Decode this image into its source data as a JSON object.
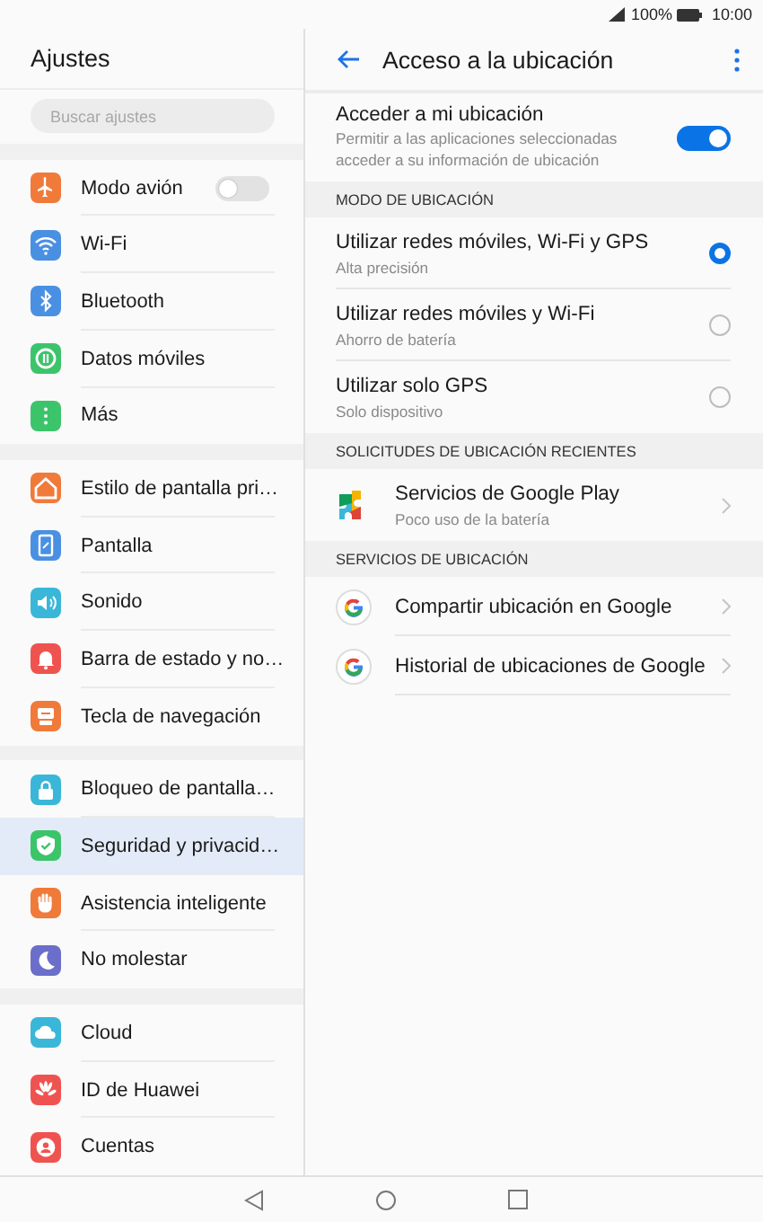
{
  "status_bar": {
    "battery": "100%",
    "time": "10:00"
  },
  "sidebar": {
    "title": "Ajustes",
    "search": {
      "placeholder": "Buscar ajustes"
    },
    "groups": [
      {
        "items": [
          {
            "label": "Modo avión",
            "color": "#f07a3a",
            "kind": "toggle",
            "on": false,
            "selected": false
          },
          {
            "label": "Wi-Fi",
            "color": "#4a90e2",
            "kind": "link",
            "selected": false
          },
          {
            "label": "Bluetooth",
            "color": "#4a90e2",
            "kind": "link",
            "selected": false
          },
          {
            "label": "Datos móviles",
            "color": "#3cc46b",
            "kind": "link",
            "selected": false
          },
          {
            "label": "Más",
            "color": "#3cc46b",
            "kind": "link",
            "selected": false
          }
        ]
      },
      {
        "items": [
          {
            "label": "Estilo de pantalla pri…",
            "color": "#f07a3a",
            "kind": "link",
            "selected": false
          },
          {
            "label": "Pantalla",
            "color": "#4a90e2",
            "kind": "link",
            "selected": false
          },
          {
            "label": "Sonido",
            "color": "#3ab7d8",
            "kind": "link",
            "selected": false
          },
          {
            "label": "Barra de estado y no…",
            "color": "#ef5350",
            "kind": "link",
            "selected": false
          },
          {
            "label": "Tecla de navegación",
            "color": "#f07a3a",
            "kind": "link",
            "selected": false
          }
        ]
      },
      {
        "items": [
          {
            "label": "Bloqueo de pantalla…",
            "color": "#3ab7d8",
            "kind": "link",
            "selected": false
          },
          {
            "label": "Seguridad y privacid…",
            "color": "#3cc46b",
            "kind": "link",
            "selected": true
          },
          {
            "label": "Asistencia inteligente",
            "color": "#f07a3a",
            "kind": "link",
            "selected": false
          },
          {
            "label": "No molestar",
            "color": "#6b6fc9",
            "kind": "link",
            "selected": false
          }
        ]
      },
      {
        "items": [
          {
            "label": "Cloud",
            "color": "#3ab7d8",
            "kind": "link",
            "selected": false
          },
          {
            "label": "ID de Huawei",
            "color": "#ef5350",
            "kind": "link",
            "selected": false
          },
          {
            "label": "Cuentas",
            "color": "#ef5350",
            "kind": "link",
            "selected": false
          }
        ]
      }
    ]
  },
  "detail": {
    "title": "Acceso a la ubicación",
    "access": {
      "label": "Acceder a mi ubicación",
      "description": "Permitir a las aplicaciones seleccionadas acceder a su información de ubicación",
      "on": true
    },
    "sections": [
      {
        "header": "MODO DE UBICACIÓN",
        "rows": [
          {
            "kind": "radio",
            "label": "Utilizar redes móviles, Wi-Fi y GPS",
            "subtitle": "Alta precisión",
            "selected": true
          },
          {
            "kind": "radio",
            "label": "Utilizar redes móviles y Wi-Fi",
            "subtitle": "Ahorro de batería",
            "selected": false
          },
          {
            "kind": "radio",
            "label": "Utilizar solo GPS",
            "subtitle": "Solo dispositivo",
            "selected": false
          }
        ]
      },
      {
        "header": "SOLICITUDES DE UBICACIÓN RECIENTES",
        "rows": [
          {
            "kind": "app",
            "label": "Servicios de Google Play",
            "subtitle": "Poco uso de la batería"
          }
        ]
      },
      {
        "header": "SERVICIOS DE UBICACIÓN",
        "rows": [
          {
            "kind": "app",
            "label": "Compartir ubicación en Google"
          },
          {
            "kind": "app",
            "label": "Historial de ubicaciones de Google"
          }
        ]
      }
    ]
  }
}
